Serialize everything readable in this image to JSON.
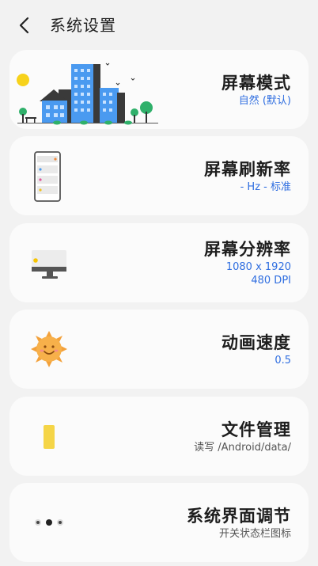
{
  "header": {
    "title": "系统设置",
    "back_icon": "chevron-left-icon"
  },
  "cards": [
    {
      "title": "屏幕模式",
      "sub": "自然 (默认)",
      "icon": "city-skyline-icon"
    },
    {
      "title": "屏幕刷新率",
      "sub": "- Hz - 标准",
      "icon": "phone-list-icon"
    },
    {
      "title": "屏幕分辨率",
      "sub1": "1080 x 1920",
      "sub2": "480 DPI",
      "icon": "monitor-icon"
    },
    {
      "title": "动画速度",
      "sub": "0.5",
      "icon": "sun-face-icon"
    },
    {
      "title": "文件管理",
      "sub": "读写 /Android/data/",
      "icon": "file-icon"
    },
    {
      "title": "系统界面调节",
      "sub": "开关状态栏图标",
      "icon": "dots-icon"
    }
  ],
  "colors": {
    "accent": "#2f6ee0",
    "background": "#f2f2f2",
    "card": "#fbfbfb"
  }
}
